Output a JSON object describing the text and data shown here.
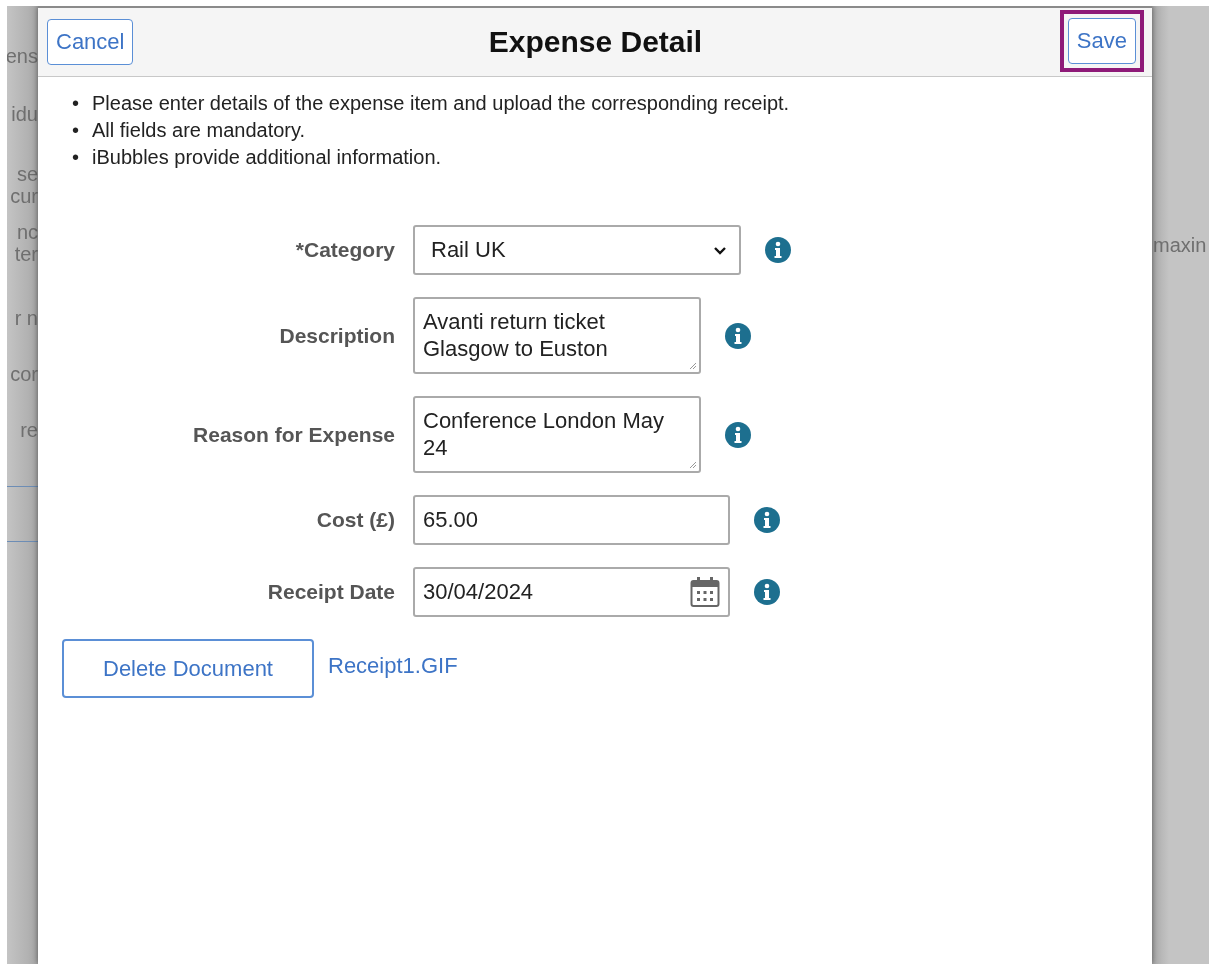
{
  "background": {
    "left_fragments": [
      "ens",
      "idu",
      "se",
      "cur",
      "nc",
      "ter",
      "r n",
      "cor",
      "re"
    ],
    "right_fragments": [
      "maxin"
    ]
  },
  "dialog": {
    "title": "Expense Detail",
    "cancel_button": "Cancel",
    "save_button": {
      "label": "Save",
      "highlighted": true
    }
  },
  "instructions": [
    {
      "marker": "•",
      "text": "Please enter details of the expense item and upload the corresponding receipt."
    },
    {
      "marker": "•",
      "text": "All fields are mandatory."
    },
    {
      "marker": "•",
      "text": "iBubbles provide additional information."
    }
  ],
  "fields": [
    {
      "kind": "select",
      "label": "*Category",
      "value": "Rail UK"
    },
    {
      "kind": "textarea",
      "label": "Description",
      "value": "Avanti return ticket Glasgow to Euston"
    },
    {
      "kind": "textarea",
      "label": "Reason for Expense",
      "value": "Conference London May 24"
    },
    {
      "kind": "text",
      "label": "Cost (£)",
      "value": "65.00"
    },
    {
      "kind": "date",
      "label": "Receipt Date",
      "value": "30/04/2024"
    }
  ],
  "attachment": {
    "delete_button": "Delete Document",
    "file_link": "Receipt1.GIF"
  }
}
